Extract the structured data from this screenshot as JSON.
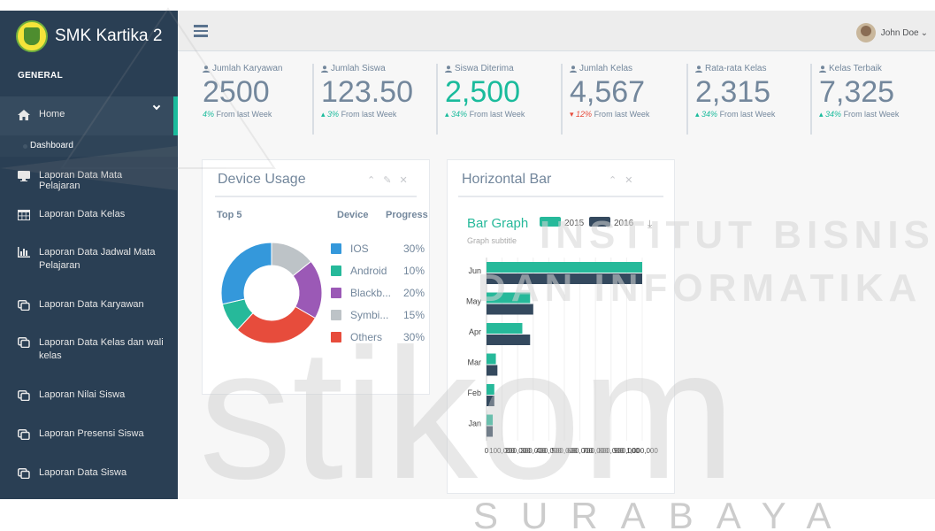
{
  "app": {
    "title": "SMK Kartika 2"
  },
  "sidebar": {
    "section": "GENERAL",
    "home_label": "Home",
    "dashboard_label": "Dashboard",
    "items": [
      {
        "label": "Laporan Data Mata Pelajaran",
        "icon": "monitor-icon"
      },
      {
        "label": "Laporan Data Kelas",
        "icon": "table-icon"
      },
      {
        "label": "Laporan Data Jadwal Mata Pelajaran",
        "icon": "bar-chart-icon"
      },
      {
        "label": "Laporan Data Karyawan",
        "icon": "clone-icon"
      },
      {
        "label": "Laporan Data Kelas dan wali kelas",
        "icon": "clone-icon"
      },
      {
        "label": "Laporan Nilai Siswa",
        "icon": "clone-icon"
      },
      {
        "label": "Laporan Presensi Siswa",
        "icon": "clone-icon"
      },
      {
        "label": "Laporan Data Siswa",
        "icon": "clone-icon"
      }
    ]
  },
  "topbar": {
    "user_name": "John Doe"
  },
  "stats": [
    {
      "label": "Jumlah Karyawan",
      "value": "2500",
      "trend": "4%",
      "foot": "From last Week",
      "dir": "up",
      "highlight": false
    },
    {
      "label": "Jumlah Siswa",
      "value": "123.50",
      "trend": "3%",
      "foot": "From last Week",
      "dir": "up",
      "highlight": false
    },
    {
      "label": "Siswa Diterima",
      "value": "2,500",
      "trend": "34%",
      "foot": "From last Week",
      "dir": "up",
      "highlight": true
    },
    {
      "label": "Jumlah Kelas",
      "value": "4,567",
      "trend": "12%",
      "foot": "From last Week",
      "dir": "down",
      "highlight": false
    },
    {
      "label": "Rata-rata Kelas",
      "value": "2,315",
      "trend": "34%",
      "foot": "From last Week",
      "dir": "up",
      "highlight": false
    },
    {
      "label": "Kelas Terbaik",
      "value": "7,325",
      "trend": "34%",
      "foot": "From last Week",
      "dir": "up",
      "highlight": false
    }
  ],
  "device_panel": {
    "title": "Device Usage",
    "top_label": "Top 5",
    "col_device": "Device",
    "col_progress": "Progress",
    "rows": [
      {
        "name": "IOS",
        "pct": "30%",
        "value": 30,
        "color": "#3498db"
      },
      {
        "name": "Android",
        "pct": "10%",
        "value": 10,
        "color": "#26b99a"
      },
      {
        "name": "Blackb...",
        "pct": "20%",
        "value": 20,
        "color": "#9b59b6"
      },
      {
        "name": "Symbi...",
        "pct": "15%",
        "value": 15,
        "color": "#bdc3c7"
      },
      {
        "name": "Others",
        "pct": "30%",
        "value": 30,
        "color": "#e74c3c"
      }
    ]
  },
  "bar_panel": {
    "title": "Horizontal Bar"
  },
  "chart_data": {
    "type": "bar",
    "orientation": "horizontal",
    "title": "Bar Graph",
    "subtitle": "Graph subtitle",
    "categories": [
      "Jun",
      "May",
      "Apr",
      "Mar",
      "Feb",
      "Jan"
    ],
    "series": [
      {
        "name": "2015",
        "color": "#26b99a",
        "values": [
          1480,
          280,
          230,
          60,
          50,
          40
        ]
      },
      {
        "name": "2016",
        "color": "#34495e",
        "values": [
          1600,
          300,
          280,
          70,
          50,
          40
        ]
      }
    ],
    "xlim": [
      0,
      1000
    ],
    "x_tick_labels": [
      "0",
      "100,000",
      "200,000",
      "300,000",
      "400,000",
      "500,000",
      "600,000",
      "700,000",
      "800,000",
      "900,000",
      "1,000,000"
    ],
    "grid": true,
    "legend": "top"
  },
  "watermark": {
    "line1": "INSTITUT BISNIS",
    "line2": "DAN INFORMATIKA",
    "big": "stikom",
    "bottom": "SURABAYA"
  }
}
